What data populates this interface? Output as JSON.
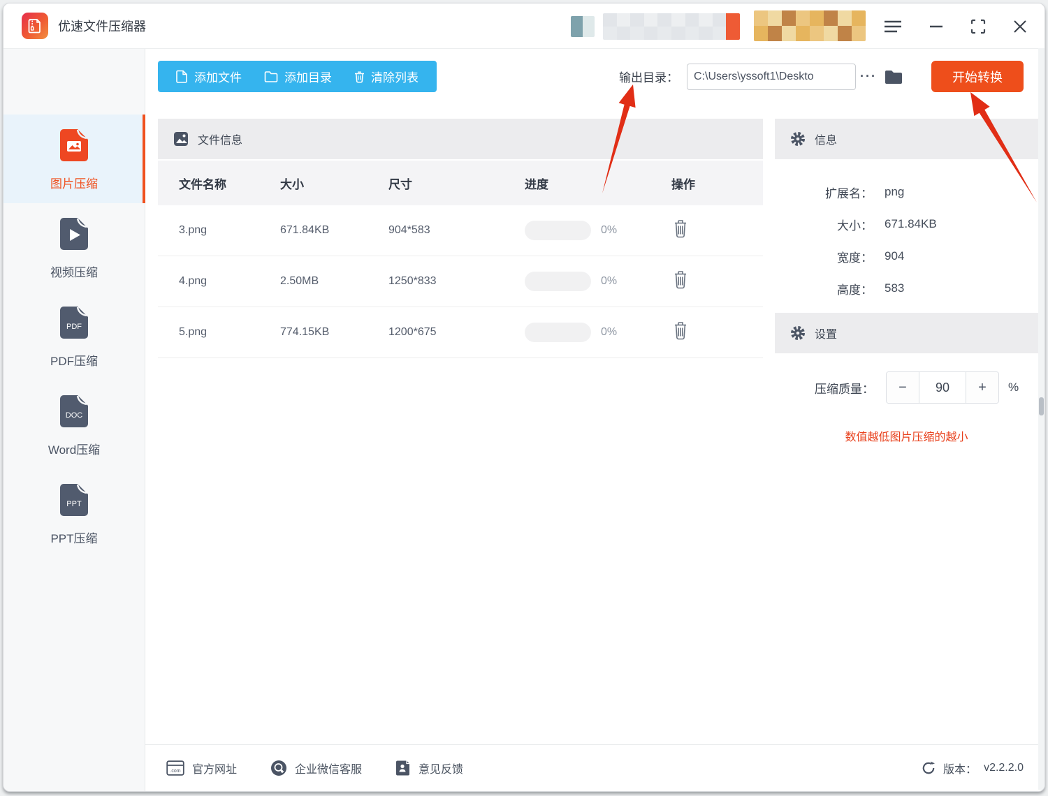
{
  "window": {
    "title": "优速文件压缩器",
    "controls": {
      "menu": "菜单",
      "minimize": "最小化",
      "maximize": "最大化",
      "close": "关闭"
    }
  },
  "toolbar": {
    "add_file": "添加文件",
    "add_dir": "添加目录",
    "clear_list": "清除列表",
    "output_label": "输出目录：",
    "output_path": "C:\\Users\\yssoft1\\Deskto",
    "more": "···",
    "start": "开始转换"
  },
  "sidebar": {
    "items": [
      {
        "label": "图片压缩",
        "badge": ""
      },
      {
        "label": "视频压缩",
        "badge": ""
      },
      {
        "label": "PDF压缩",
        "badge": "PDF"
      },
      {
        "label": "Word压缩",
        "badge": "DOC"
      },
      {
        "label": "PPT压缩",
        "badge": "PPT"
      }
    ]
  },
  "file_panel": {
    "title": "文件信息",
    "columns": [
      "文件名称",
      "大小",
      "尺寸",
      "进度",
      "操作"
    ],
    "rows": [
      {
        "name": "3.png",
        "size": "671.84KB",
        "dimensions": "904*583",
        "progress": "0%"
      },
      {
        "name": "4.png",
        "size": "2.50MB",
        "dimensions": "1250*833",
        "progress": "0%"
      },
      {
        "name": "5.png",
        "size": "774.15KB",
        "dimensions": "1200*675",
        "progress": "0%"
      }
    ]
  },
  "info_panel": {
    "title": "信息",
    "fields": [
      {
        "label": "扩展名：",
        "value": "png"
      },
      {
        "label": "大小：",
        "value": "671.84KB"
      },
      {
        "label": "宽度：",
        "value": "904"
      },
      {
        "label": "高度：",
        "value": "583"
      }
    ]
  },
  "settings_panel": {
    "title": "设置",
    "quality_label": "压缩质量：",
    "minus": "−",
    "value": "90",
    "plus": "+",
    "unit": "%",
    "note": "数值越低图片压缩的越小"
  },
  "footer": {
    "links": [
      {
        "label": "官方网址"
      },
      {
        "label": "企业微信客服"
      },
      {
        "label": "意见反馈"
      }
    ],
    "version_label": "版本：",
    "version": "v2.2.2.0"
  },
  "colors": {
    "accent_blue": "#35b4ee",
    "accent_orange": "#ee4e1b",
    "active_orange": "#f0511f",
    "slate_icon": "#515b6e",
    "note_red": "#e8401c",
    "arrow_red": "#e12e16"
  },
  "censored": {
    "chip1": {
      "cols": 2,
      "rows": 2,
      "palette": [
        "#7ea2ac",
        "#b9cdd2",
        "#dfe9ea",
        "#8fb4bd"
      ]
    },
    "chip2": {
      "cols": 10,
      "rows": 2,
      "palette": [
        "#e2e5e9",
        "#edeff1",
        "#dadde2",
        "#f1f2f4",
        "#e7eaed"
      ],
      "accent": [
        "#ee5b35",
        "#e84b22"
      ],
      "accent_cols": 1
    },
    "chip3": {
      "cols": 8,
      "rows": 2,
      "palette": [
        "#ecc680",
        "#dca94f",
        "#c08347",
        "#8e5c3e",
        "#e6b55e",
        "#cfa055",
        "#f0d9a2",
        "#aa764a"
      ]
    }
  }
}
